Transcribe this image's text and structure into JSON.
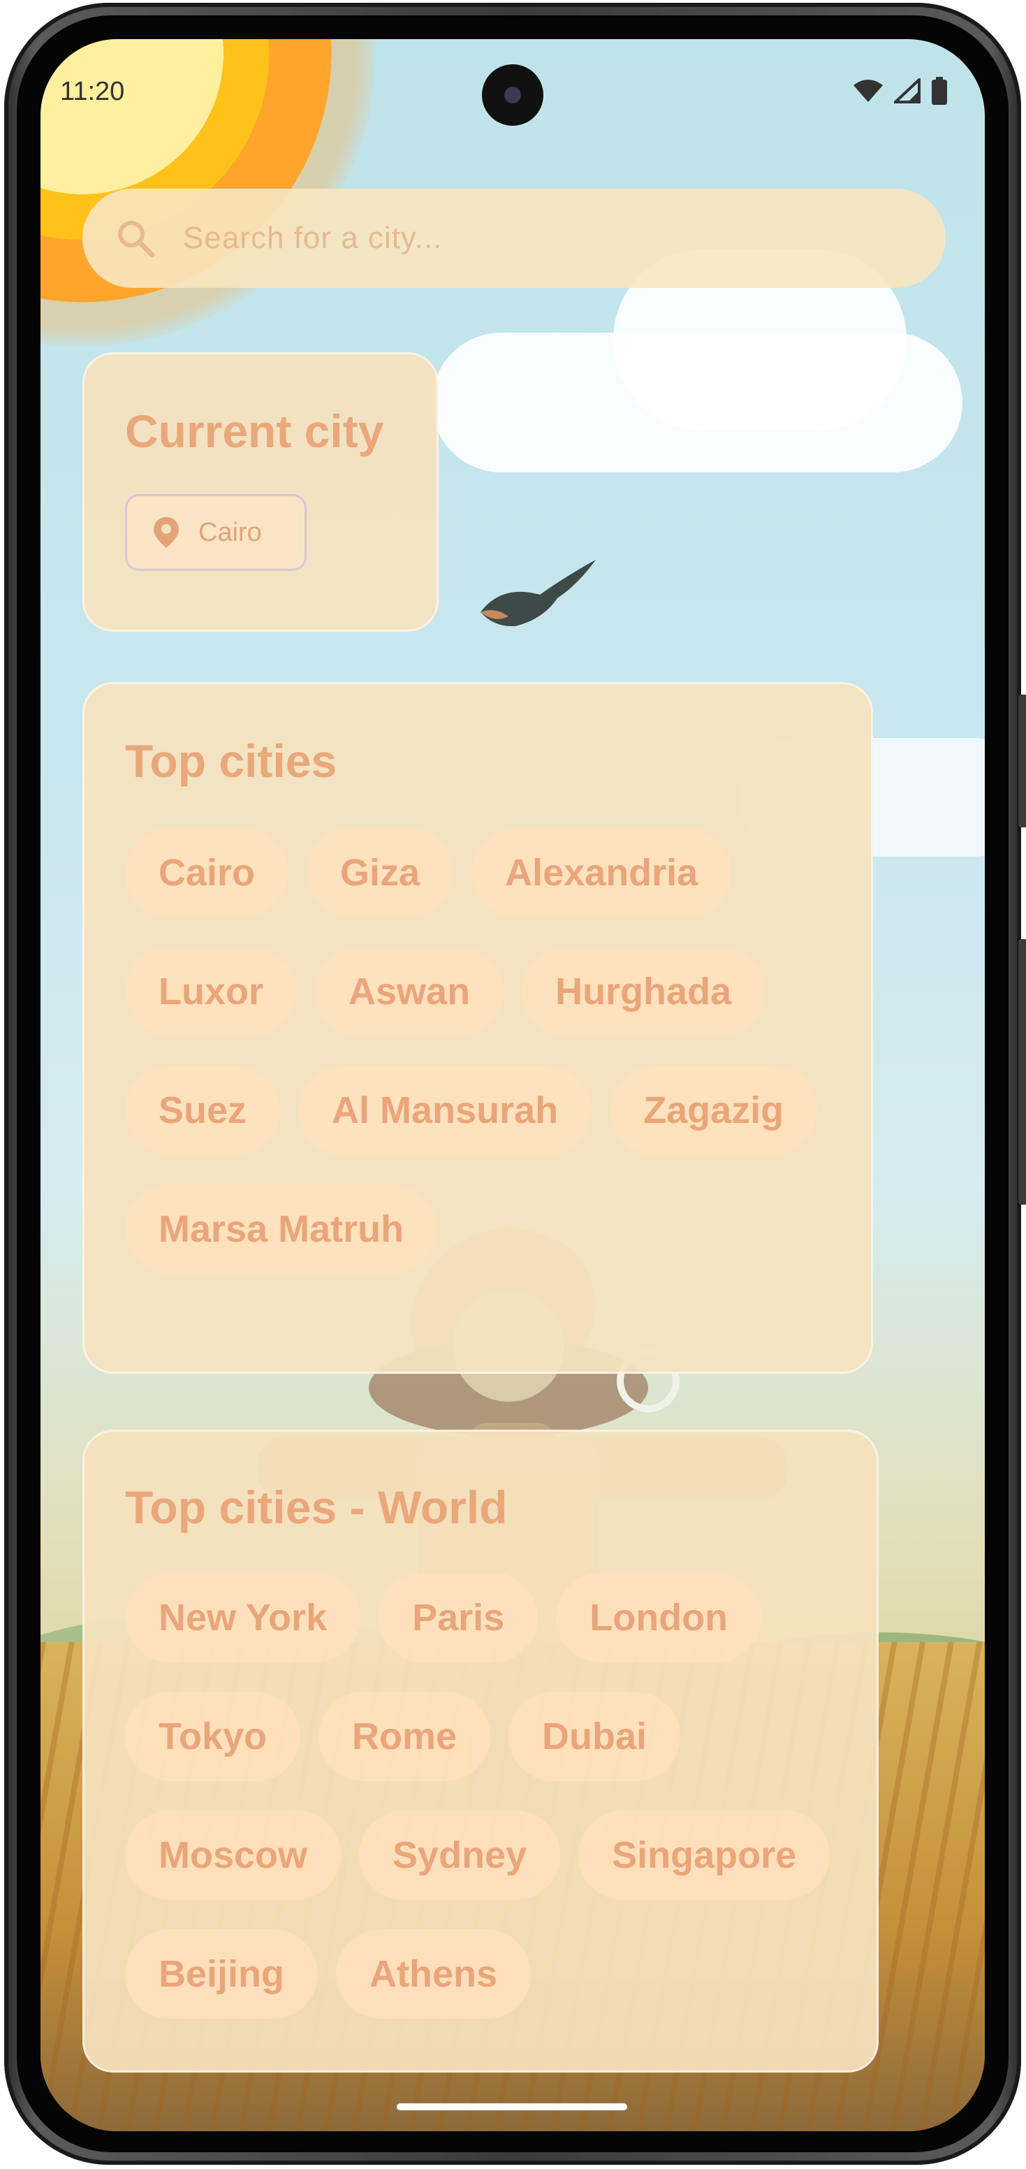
{
  "status_bar": {
    "time": "11:20"
  },
  "search": {
    "placeholder": "Search for a city..."
  },
  "current_city": {
    "title": "Current city",
    "city": "Cairo"
  },
  "top_cities": {
    "title": "Top cities",
    "items": [
      "Cairo",
      "Giza",
      "Alexandria",
      "Luxor",
      "Aswan",
      "Hurghada",
      "Suez",
      "Al Mansurah",
      "Zagazig",
      "Marsa Matruh"
    ]
  },
  "top_cities_world": {
    "title": "Top cities - World",
    "items": [
      "New York",
      "Paris",
      "London",
      "Tokyo",
      "Rome",
      "Dubai",
      "Moscow",
      "Sydney",
      "Singapore",
      "Beijing",
      "Athens"
    ]
  },
  "colors": {
    "accent_text": "#eaa57b",
    "card_bg": "#f5e2be",
    "chip_bg": "#ffe0bc"
  },
  "icons": {
    "search": "search-icon",
    "location": "location-pin-icon"
  }
}
